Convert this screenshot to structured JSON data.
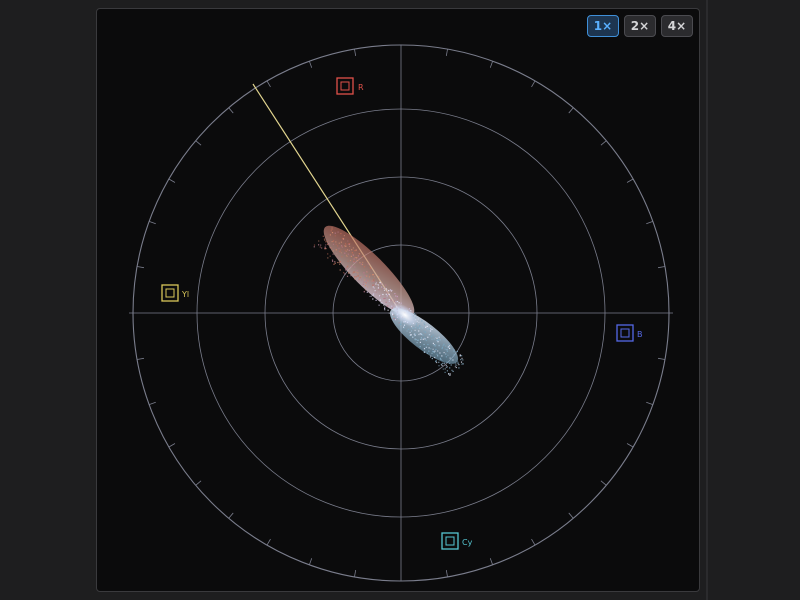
{
  "zoom": {
    "options": [
      {
        "label": "1×",
        "active": true
      },
      {
        "label": "2×",
        "active": false
      },
      {
        "label": "4×",
        "active": false
      }
    ]
  },
  "targets": {
    "R": {
      "label": "R",
      "color": "#e0524a"
    },
    "Yl": {
      "label": "Yl",
      "color": "#d9c75a"
    },
    "B": {
      "label": "B",
      "color": "#5568e6"
    },
    "Cy": {
      "label": "Cy",
      "color": "#56c6d2"
    }
  },
  "colors": {
    "graticule": "#7a7d8c",
    "skin_tone_line": "#e2d58f",
    "background": "#0b0b0c"
  }
}
